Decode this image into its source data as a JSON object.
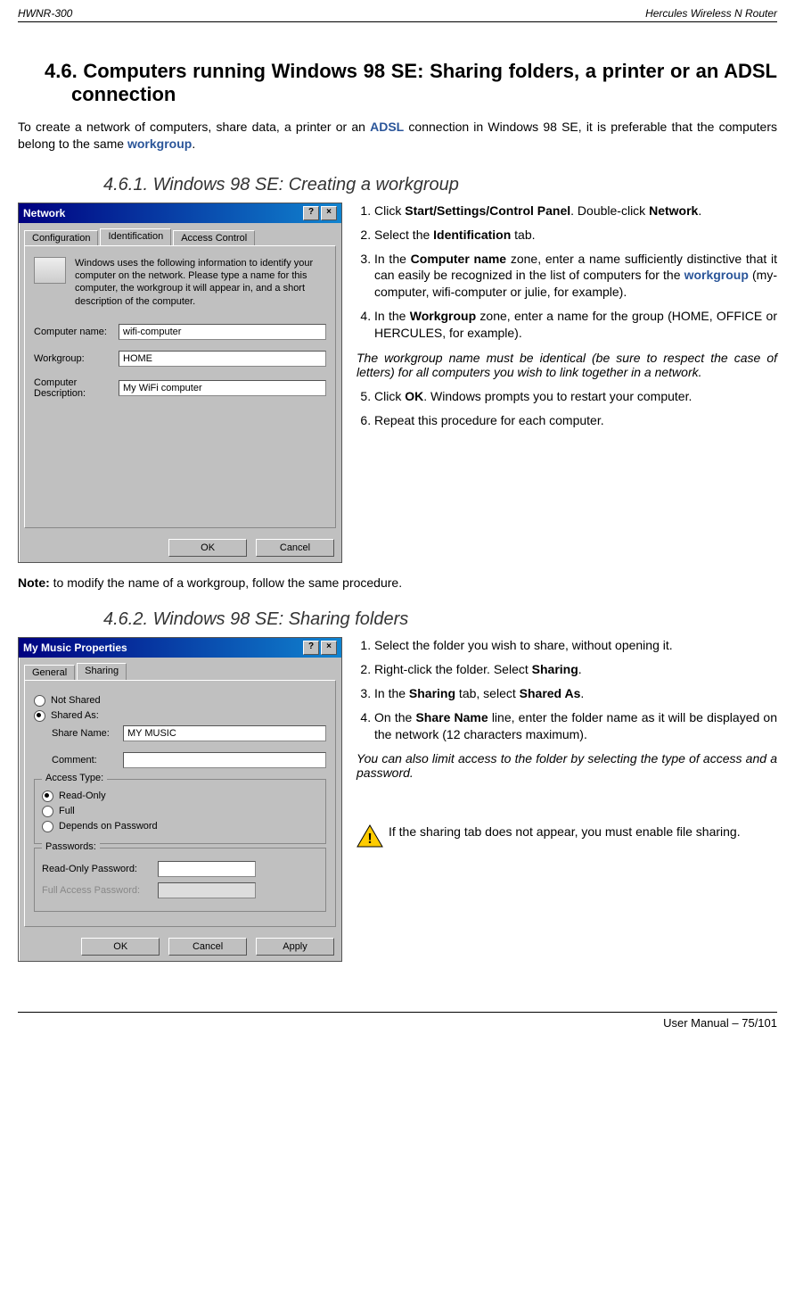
{
  "header": {
    "left": "HWNR-300",
    "right": "Hercules Wireless N Router"
  },
  "section46": {
    "number": "4.6.",
    "title": "Computers running Windows 98 SE: Sharing folders, a printer or an ADSL connection"
  },
  "intro": {
    "p1a": "To create a network of computers, share data, a printer or an ",
    "adsl": "ADSL",
    "p1b": " connection in Windows 98 SE, it is preferable that the computers belong to the same ",
    "wg": "workgroup",
    "p1c": "."
  },
  "sub461": {
    "title": "4.6.1. Windows 98 SE: Creating a workgroup"
  },
  "dialog1": {
    "title": "Network",
    "tabs": [
      "Configuration",
      "Identification",
      "Access Control"
    ],
    "info": "Windows uses the following information to identify your computer on the network. Please type a name for this computer, the workgroup it will appear in, and a short description of the computer.",
    "labels": {
      "cname": "Computer name:",
      "wg": "Workgroup:",
      "desc": "Computer Description:"
    },
    "values": {
      "cname": "wifi-computer",
      "wg": "HOME",
      "desc": "My WiFi computer"
    },
    "ok": "OK",
    "cancel": "Cancel"
  },
  "steps1": {
    "s1a": "Click ",
    "s1b": "Start/Settings/Control Panel",
    "s1c": ". Double-click ",
    "s1d": "Network",
    "s1e": ".",
    "s2a": "Select the ",
    "s2b": "Identification",
    "s2c": " tab.",
    "s3a": "In the ",
    "s3b": "Computer name",
    "s3c": " zone, enter a name sufficiently distinctive that it can easily be recognized in the list of computers for the ",
    "s3wg": "workgroup",
    "s3d": " (my-computer, wifi-computer or julie, for example).",
    "s4a": "In the ",
    "s4b": "Workgroup",
    "s4c": " zone, enter a name for the group (HOME, OFFICE or HERCULES, for example).",
    "note": "The workgroup name must be identical (be sure to respect the case of letters) for all computers you wish to link together in a network.",
    "s5a": "Click ",
    "s5b": "OK",
    "s5c": ". Windows prompts you to restart your computer.",
    "s6": "Repeat this procedure for each computer."
  },
  "noteLine": {
    "b": "Note:",
    "t": " to modify the name of a workgroup, follow the same procedure."
  },
  "sub462": {
    "title": "4.6.2. Windows 98 SE: Sharing folders"
  },
  "dialog2": {
    "title": "My Music Properties",
    "tabs": [
      "General",
      "Sharing"
    ],
    "notshared": "Not Shared",
    "sharedas": "Shared As:",
    "sharename_lbl": "Share Name:",
    "sharename_val": "MY MUSIC",
    "comment_lbl": "Comment:",
    "accesstype": "Access Type:",
    "readonly": "Read-Only",
    "full": "Full",
    "depends": "Depends on Password",
    "passwords": "Passwords:",
    "ropw": "Read-Only Password:",
    "fapw": "Full Access Password:",
    "ok": "OK",
    "cancel": "Cancel",
    "apply": "Apply"
  },
  "steps2": {
    "s1": "Select the folder you wish to share, without opening it.",
    "s2a": "Right-click the folder. Select ",
    "s2b": "Sharing",
    "s2c": ".",
    "s3a": "In the ",
    "s3b": "Sharing",
    "s3c": " tab, select ",
    "s3d": "Shared As",
    "s3e": ".",
    "s4a": "On the ",
    "s4b": "Share Name",
    "s4c": " line, enter the folder name as it will be displayed on the network (12 characters maximum).",
    "note": "You can also limit access to the folder by selecting the type of access and a password."
  },
  "warning": " If the sharing tab does not appear, you must enable file sharing.",
  "footer": "User Manual – 75/101"
}
